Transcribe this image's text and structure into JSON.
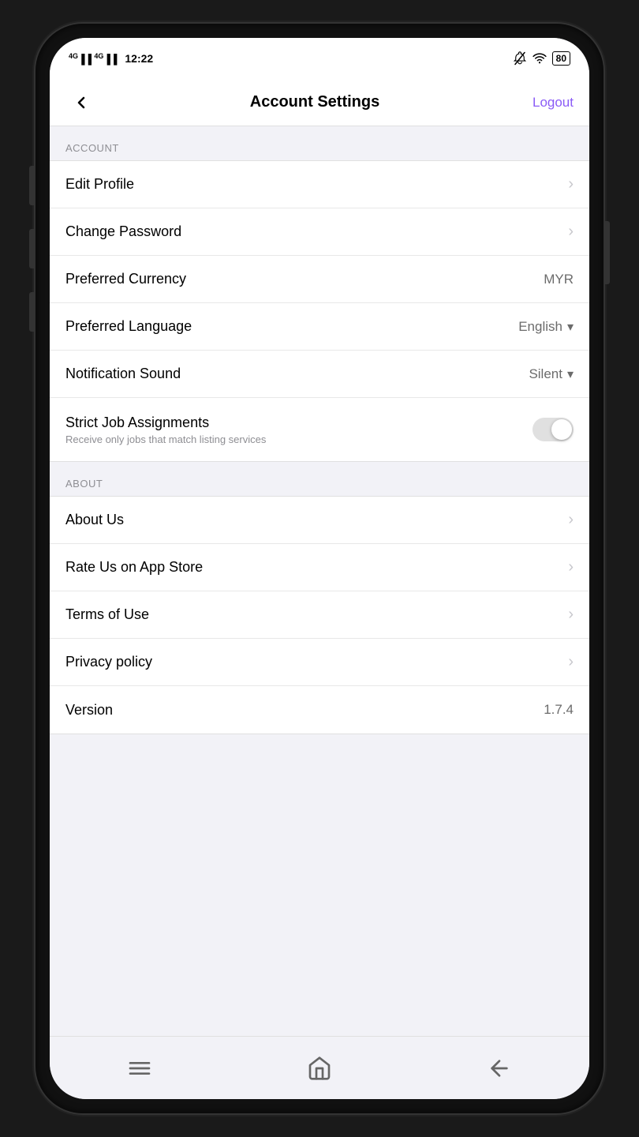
{
  "status": {
    "time": "12:22",
    "network1": "4G",
    "network2": "4G",
    "battery": "80"
  },
  "header": {
    "back_label": "‹",
    "title": "Account Settings",
    "logout_label": "Logout"
  },
  "sections": {
    "account": {
      "label": "ACCOUNT",
      "items": [
        {
          "id": "edit-profile",
          "label": "Edit Profile",
          "type": "arrow",
          "value": ""
        },
        {
          "id": "change-password",
          "label": "Change Password",
          "type": "arrow",
          "value": ""
        },
        {
          "id": "preferred-currency",
          "label": "Preferred Currency",
          "type": "value",
          "value": "MYR"
        },
        {
          "id": "preferred-language",
          "label": "Preferred Language",
          "type": "dropdown",
          "value": "English"
        },
        {
          "id": "notification-sound",
          "label": "Notification Sound",
          "type": "dropdown",
          "value": "Silent"
        },
        {
          "id": "strict-job-assignments",
          "label": "Strict Job Assignments",
          "sublabel": "Receive only jobs that match listing services",
          "type": "toggle",
          "value": false
        }
      ]
    },
    "about": {
      "label": "ABOUT",
      "items": [
        {
          "id": "about-us",
          "label": "About Us",
          "type": "arrow",
          "value": ""
        },
        {
          "id": "rate-us",
          "label": "Rate Us on App Store",
          "type": "arrow",
          "value": ""
        },
        {
          "id": "terms-of-use",
          "label": "Terms of Use",
          "type": "arrow",
          "value": ""
        },
        {
          "id": "privacy-policy",
          "label": "Privacy policy",
          "type": "arrow",
          "value": ""
        },
        {
          "id": "version",
          "label": "Version",
          "type": "version",
          "value": "1.7.4"
        }
      ]
    }
  },
  "bottom_nav": {
    "menu_icon": "menu",
    "home_icon": "home",
    "back_icon": "back"
  }
}
